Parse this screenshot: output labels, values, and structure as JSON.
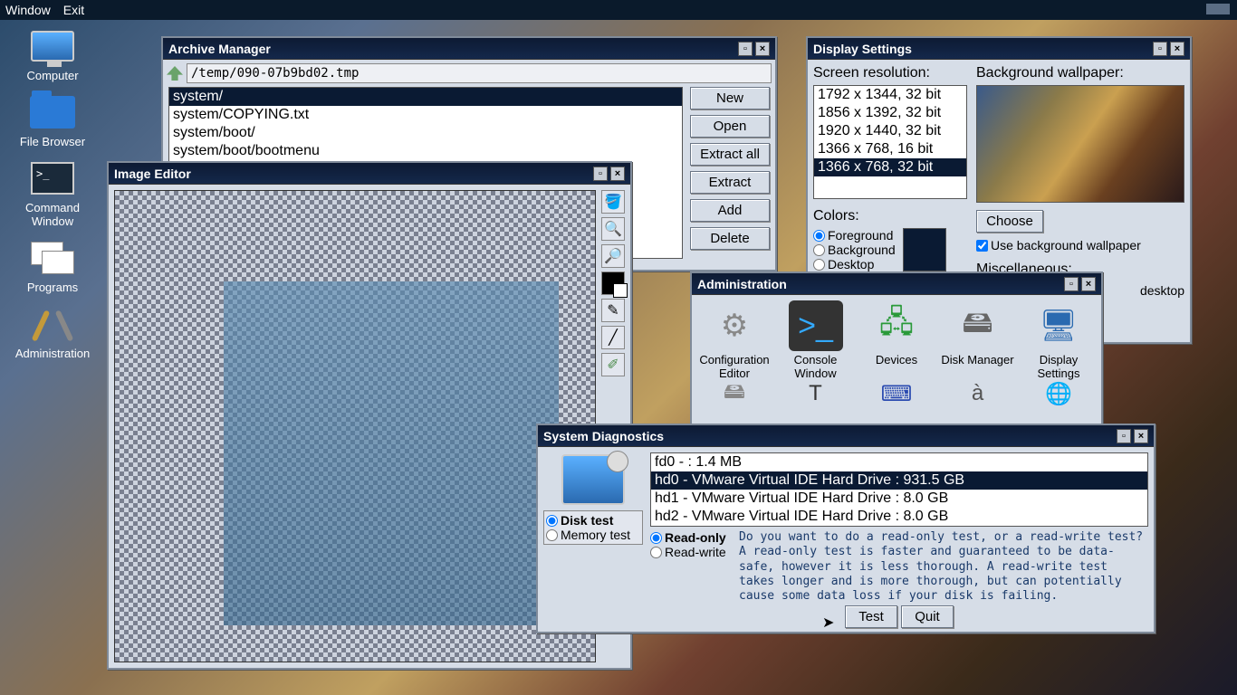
{
  "menubar": {
    "window": "Window",
    "exit": "Exit"
  },
  "desktop": {
    "computer": "Computer",
    "filebrowser": "File Browser",
    "cmdwin": "Command Window",
    "programs": "Programs",
    "admin": "Administration"
  },
  "archive": {
    "title": "Archive Manager",
    "path": "/temp/090-07b9bd02.tmp",
    "files": [
      "system/",
      "system/COPYING.txt",
      "system/boot/",
      "system/boot/bootmenu"
    ],
    "buttons": {
      "new": "New",
      "open": "Open",
      "extractall": "Extract all",
      "extract": "Extract",
      "add": "Add",
      "delete": "Delete"
    }
  },
  "imged": {
    "title": "Image Editor"
  },
  "display": {
    "title": "Display Settings",
    "reslabel": "Screen resolution:",
    "resolutions": [
      "1792 x 1344, 32 bit",
      "1856 x 1392, 32 bit",
      "1920 x 1440, 32 bit",
      "1366 x 768, 16 bit",
      "1366 x 768, 32 bit"
    ],
    "colorslabel": "Colors:",
    "fg": "Foreground",
    "bg": "Background",
    "dk": "Desktop",
    "wplabel": "Background wallpaper:",
    "choose": "Choose",
    "usewp": "Use background wallpaper",
    "misclabel": "Miscellaneous:",
    "centerdesktop": "desktop"
  },
  "admin": {
    "title": "Administration",
    "items": {
      "confed": "Configuration Editor",
      "conswin": "Console Window",
      "devices": "Devices",
      "diskmgr": "Disk Manager",
      "dispset": "Display Settings"
    }
  },
  "diag": {
    "title": "System Diagnostics",
    "disktest": "Disk test",
    "memtest": "Memory test",
    "drives": [
      "fd0 -  : 1.4 MB",
      "hd0 - VMware Virtual IDE Hard Drive : 931.5 GB",
      "hd1 - VMware Virtual IDE Hard Drive : 8.0 GB",
      "hd2 - VMware Virtual IDE Hard Drive : 8.0 GB"
    ],
    "readonly": "Read-only",
    "readwrite": "Read-write",
    "desc": "Do you want to do a read-only test, or a read-write test?  A read-only test is faster and guaranteed to be data-safe, however it is less thorough.  A read-write test takes longer and is more thorough, but can potentially cause some data loss if your disk is failing.",
    "test": "Test",
    "quit": "Quit"
  }
}
